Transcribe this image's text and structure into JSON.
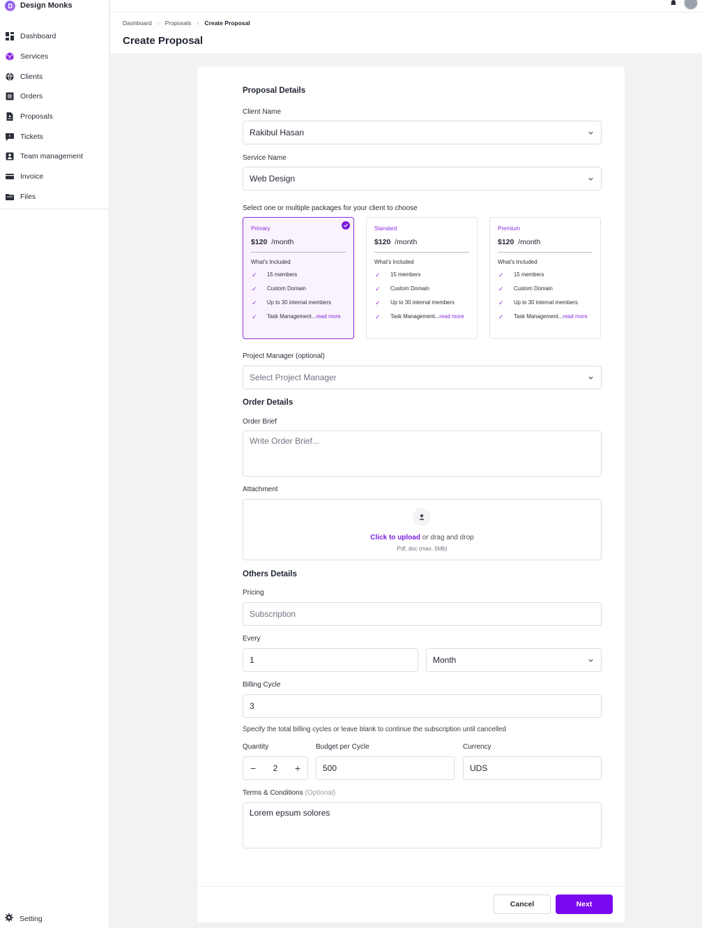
{
  "brand": {
    "name": "Design Monks"
  },
  "sidebar": {
    "items": [
      {
        "label": "Dashboard",
        "icon": "dashboard-icon"
      },
      {
        "label": "Services",
        "icon": "cube-icon"
      },
      {
        "label": "Clients",
        "icon": "globe-icon"
      },
      {
        "label": "Orders",
        "icon": "orders-icon"
      },
      {
        "label": "Proposals",
        "icon": "document-icon"
      },
      {
        "label": "Tickets",
        "icon": "ticket-icon"
      },
      {
        "label": "Team management",
        "icon": "team-icon"
      },
      {
        "label": "Invoice",
        "icon": "invoice-icon"
      },
      {
        "label": "Files",
        "icon": "folder-icon"
      }
    ],
    "setting_label": "Setting"
  },
  "breadcrumb": [
    "Dashboard",
    "Proposals",
    "Create Proposal"
  ],
  "page_title": "Create Proposal",
  "form": {
    "proposal_details_title": "Proposal Details",
    "client_name_label": "Client Name",
    "client_name_value": "Rakibul Hasan",
    "service_name_label": "Service Name",
    "service_name_value": "Web Design",
    "packages_label": "Select one or multiple packages for your client to choose",
    "packages": [
      {
        "name": "Primary",
        "price": "$120",
        "period": "/month",
        "selected": true,
        "included_label": "What's Included",
        "features": [
          "15 members",
          "Custom Domain",
          "Up to 30 internal members"
        ],
        "last_feature": "Task Management...",
        "read_more": "read more"
      },
      {
        "name": "Standard",
        "price": "$120",
        "period": "/month",
        "selected": false,
        "included_label": "What's Included",
        "features": [
          "15 members",
          "Custom Domain",
          "Up to 30 internal members"
        ],
        "last_feature": "Task Management...",
        "read_more": "read more"
      },
      {
        "name": "Premium",
        "price": "$120",
        "period": "/month",
        "selected": false,
        "included_label": "What's Included",
        "features": [
          "15 members",
          "Custom Domain",
          "Up to 30 internal members"
        ],
        "last_feature": "Task Management...",
        "read_more": "read more"
      }
    ],
    "project_manager_label": "Project Manager (optional)",
    "project_manager_placeholder": "Select Project Manager",
    "order_details_title": "Order Details",
    "order_brief_label": "Order Brief",
    "order_brief_placeholder": "Write Order Brief...",
    "attachment_label": "Attachment",
    "upload_click": "Click to upload",
    "upload_rest": " or drag and drop",
    "upload_hint": "Pdf, doc  (max. 5Mb)",
    "others_details_title": "Others Details",
    "pricing_label": "Pricing",
    "pricing_placeholder": "Subscription",
    "every_label": "Every",
    "every_value": "1",
    "every_unit": "Month",
    "billing_cycle_label": "Billing Cycle",
    "billing_cycle_value": "3",
    "billing_cycle_help": "Specify the total billing cycles or leave blank to continue the subscription until cancelled",
    "quantity_label": "Quantity",
    "quantity_value": "2",
    "budget_label": "Budget per Cycle",
    "budget_value": "500",
    "currency_label": "Currency",
    "currency_value": "UDS",
    "terms_label": "Terms & Conditions",
    "terms_optional": "(Optional)",
    "terms_value": "Lorem epsum solores"
  },
  "actions": {
    "cancel": "Cancel",
    "next": "Next"
  },
  "colors": {
    "accent": "#7a08f0",
    "selected_bg": "#faf3fd"
  }
}
